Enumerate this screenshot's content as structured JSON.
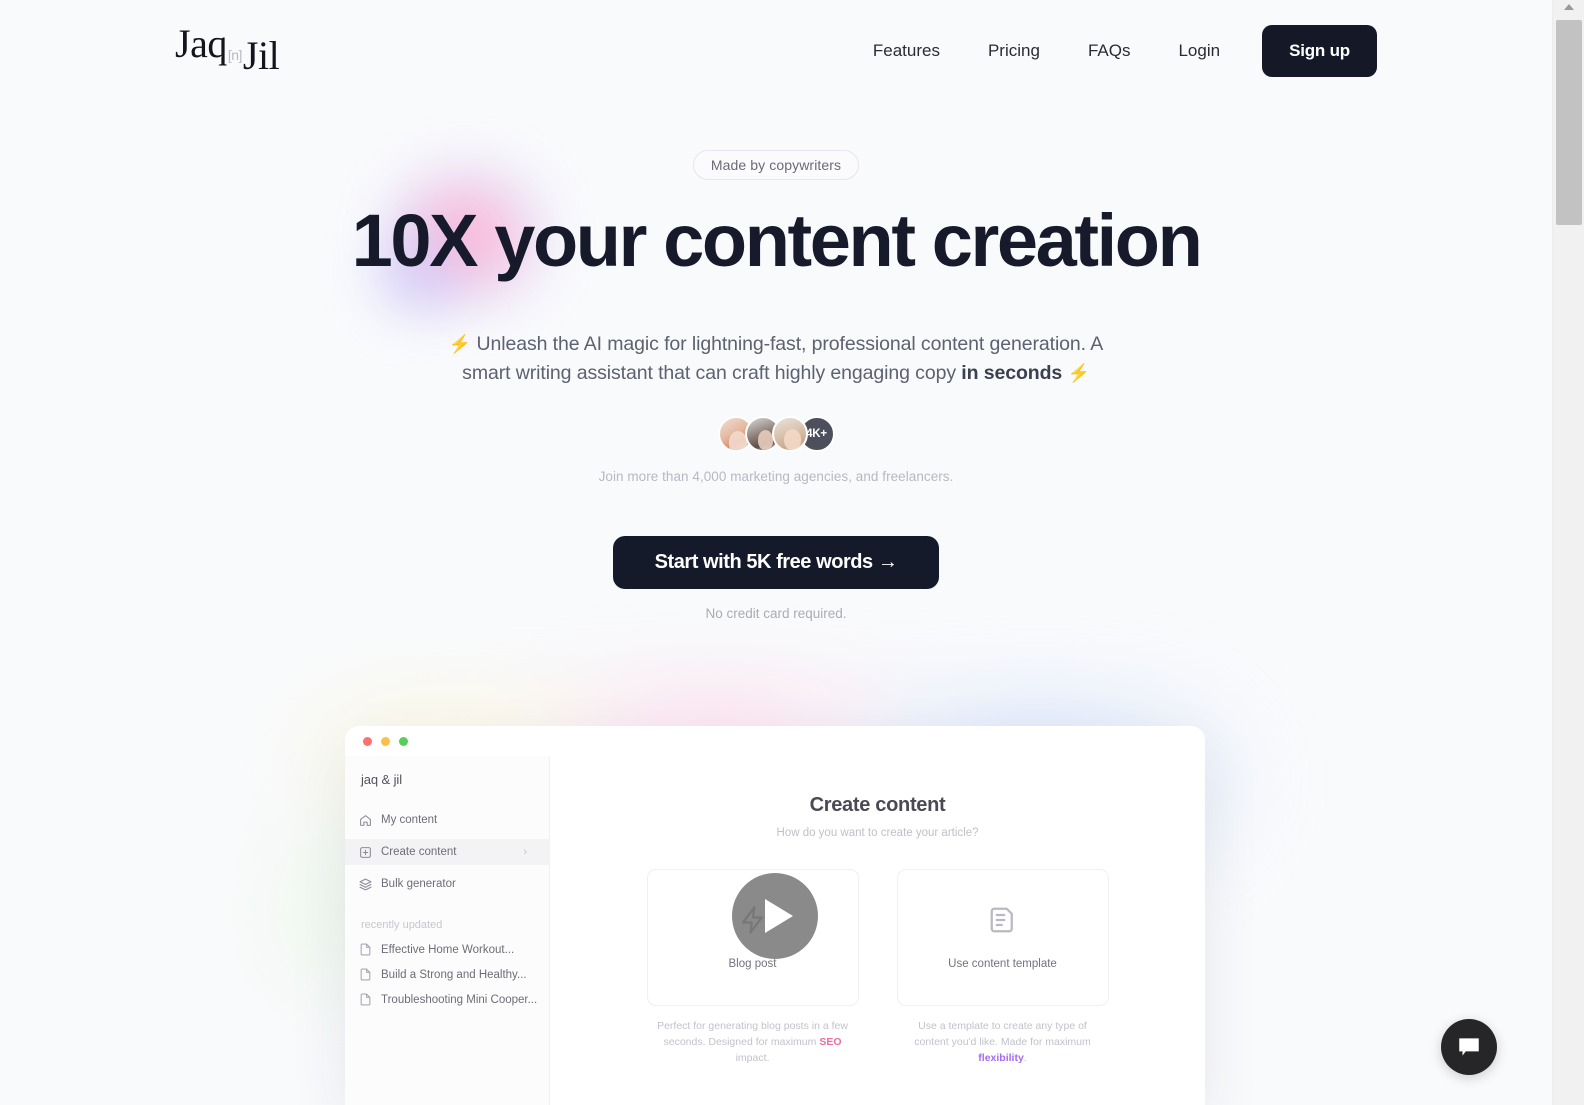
{
  "brand": {
    "logo_first": "Jaq",
    "logo_mid": "[n]",
    "logo_last": "Jil"
  },
  "nav": {
    "links": [
      {
        "label": "Features"
      },
      {
        "label": "Pricing"
      },
      {
        "label": "FAQs"
      },
      {
        "label": "Login"
      }
    ],
    "signup_label": "Sign up"
  },
  "hero": {
    "badge": "Made by copywriters",
    "headline_highlight": "10X",
    "headline_rest": " your content creation",
    "subhead_line1": "Unleash the AI magic for lightning-fast, professional content generation. A smart",
    "subhead_line2a": "writing assistant that can craft highly engaging copy ",
    "subhead_bold": "in seconds",
    "bolt_left": "⚡",
    "bolt_right": "⚡",
    "avatar_count": "4K+",
    "join_text": "Join more than 4,000 marketing agencies, and freelancers.",
    "cta_label": "Start with 5K free words →",
    "no_credit_card": "No credit card required."
  },
  "mockup": {
    "brand": "jaq & jil",
    "sidebar_items": [
      {
        "label": "My content",
        "icon": "home-icon",
        "active": false
      },
      {
        "label": "Create content",
        "icon": "plus-square-icon",
        "active": true
      },
      {
        "label": "Bulk generator",
        "icon": "layers-icon",
        "active": false
      }
    ],
    "recent_label": "recently updated",
    "recent_items": [
      {
        "label": "Effective Home Workout..."
      },
      {
        "label": "Build a Strong and Healthy..."
      },
      {
        "label": "Troubleshooting Mini Cooper..."
      }
    ],
    "title": "Create content",
    "subtitle": "How do you want to create your article?",
    "cards": [
      {
        "label": "Blog post",
        "icon": "lightning-icon",
        "desc_a": "Perfect for generating blog posts in a few seconds. Designed for maximum ",
        "desc_hl": "SEO",
        "desc_b": " impact."
      },
      {
        "label": "Use content template",
        "icon": "document-icon",
        "desc_a": "Use a template to create any type of content you'd like. Made for maximum ",
        "desc_hl": "flexibility",
        "desc_b": "."
      }
    ]
  },
  "widgets": {
    "chat_icon": "chat-bubble-icon",
    "play_icon": "play-icon"
  },
  "colors": {
    "background": "#f9fafc",
    "dark": "#141827",
    "accent_orange": "#f5802a",
    "accent_pink": "#f06ba0",
    "accent_purple": "#a46bf0"
  }
}
